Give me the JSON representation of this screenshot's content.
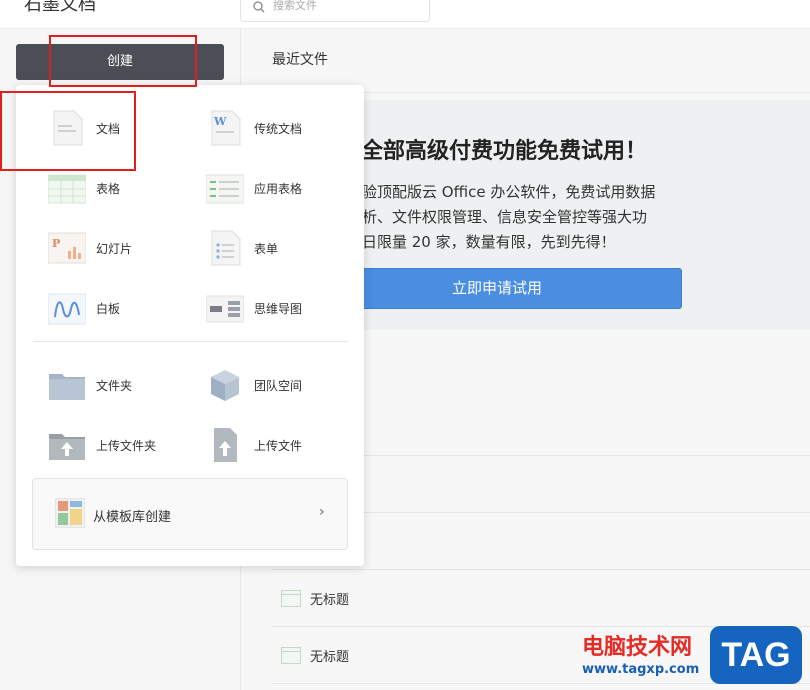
{
  "app": {
    "brand": "石墨文档"
  },
  "search": {
    "placeholder": "搜索文件"
  },
  "sidebar": {
    "create_label": "创建"
  },
  "main": {
    "recent_title": "最近文件",
    "banner": {
      "title": "全部高级付费功能免费试用！",
      "lines": [
        "验顶配版云 Office 办公软件，免费试用数据",
        "析、文件权限管理、信息安全管控等强大功",
        "日限量 20 家，数量有限，先到先得！"
      ],
      "button": "立即申请试用"
    },
    "files": [
      {
        "name": "无标题"
      },
      {
        "name": "无标题"
      }
    ]
  },
  "create_menu": {
    "items": [
      {
        "label": "文档",
        "icon": "doc-icon"
      },
      {
        "label": "传统文档",
        "icon": "word-doc-icon"
      },
      {
        "label": "表格",
        "icon": "sheet-icon"
      },
      {
        "label": "应用表格",
        "icon": "app-sheet-icon"
      },
      {
        "label": "幻灯片",
        "icon": "slides-icon"
      },
      {
        "label": "表单",
        "icon": "form-icon"
      },
      {
        "label": "白板",
        "icon": "whiteboard-icon"
      },
      {
        "label": "思维导图",
        "icon": "mindmap-icon"
      },
      {
        "label": "文件夹",
        "icon": "folder-icon"
      },
      {
        "label": "团队空间",
        "icon": "team-space-icon"
      },
      {
        "label": "上传文件夹",
        "icon": "upload-folder-icon"
      },
      {
        "label": "上传文件",
        "icon": "upload-file-icon"
      }
    ],
    "template_label": "从模板库创建",
    "template_chevron": "›"
  },
  "watermark": {
    "site_name": "电脑技术网",
    "url": "www.tagxp.com",
    "tag": "TAG"
  },
  "colors": {
    "accent_button": "#4a8ee0",
    "create_button": "#4b4e54",
    "highlight": "#e02020"
  }
}
